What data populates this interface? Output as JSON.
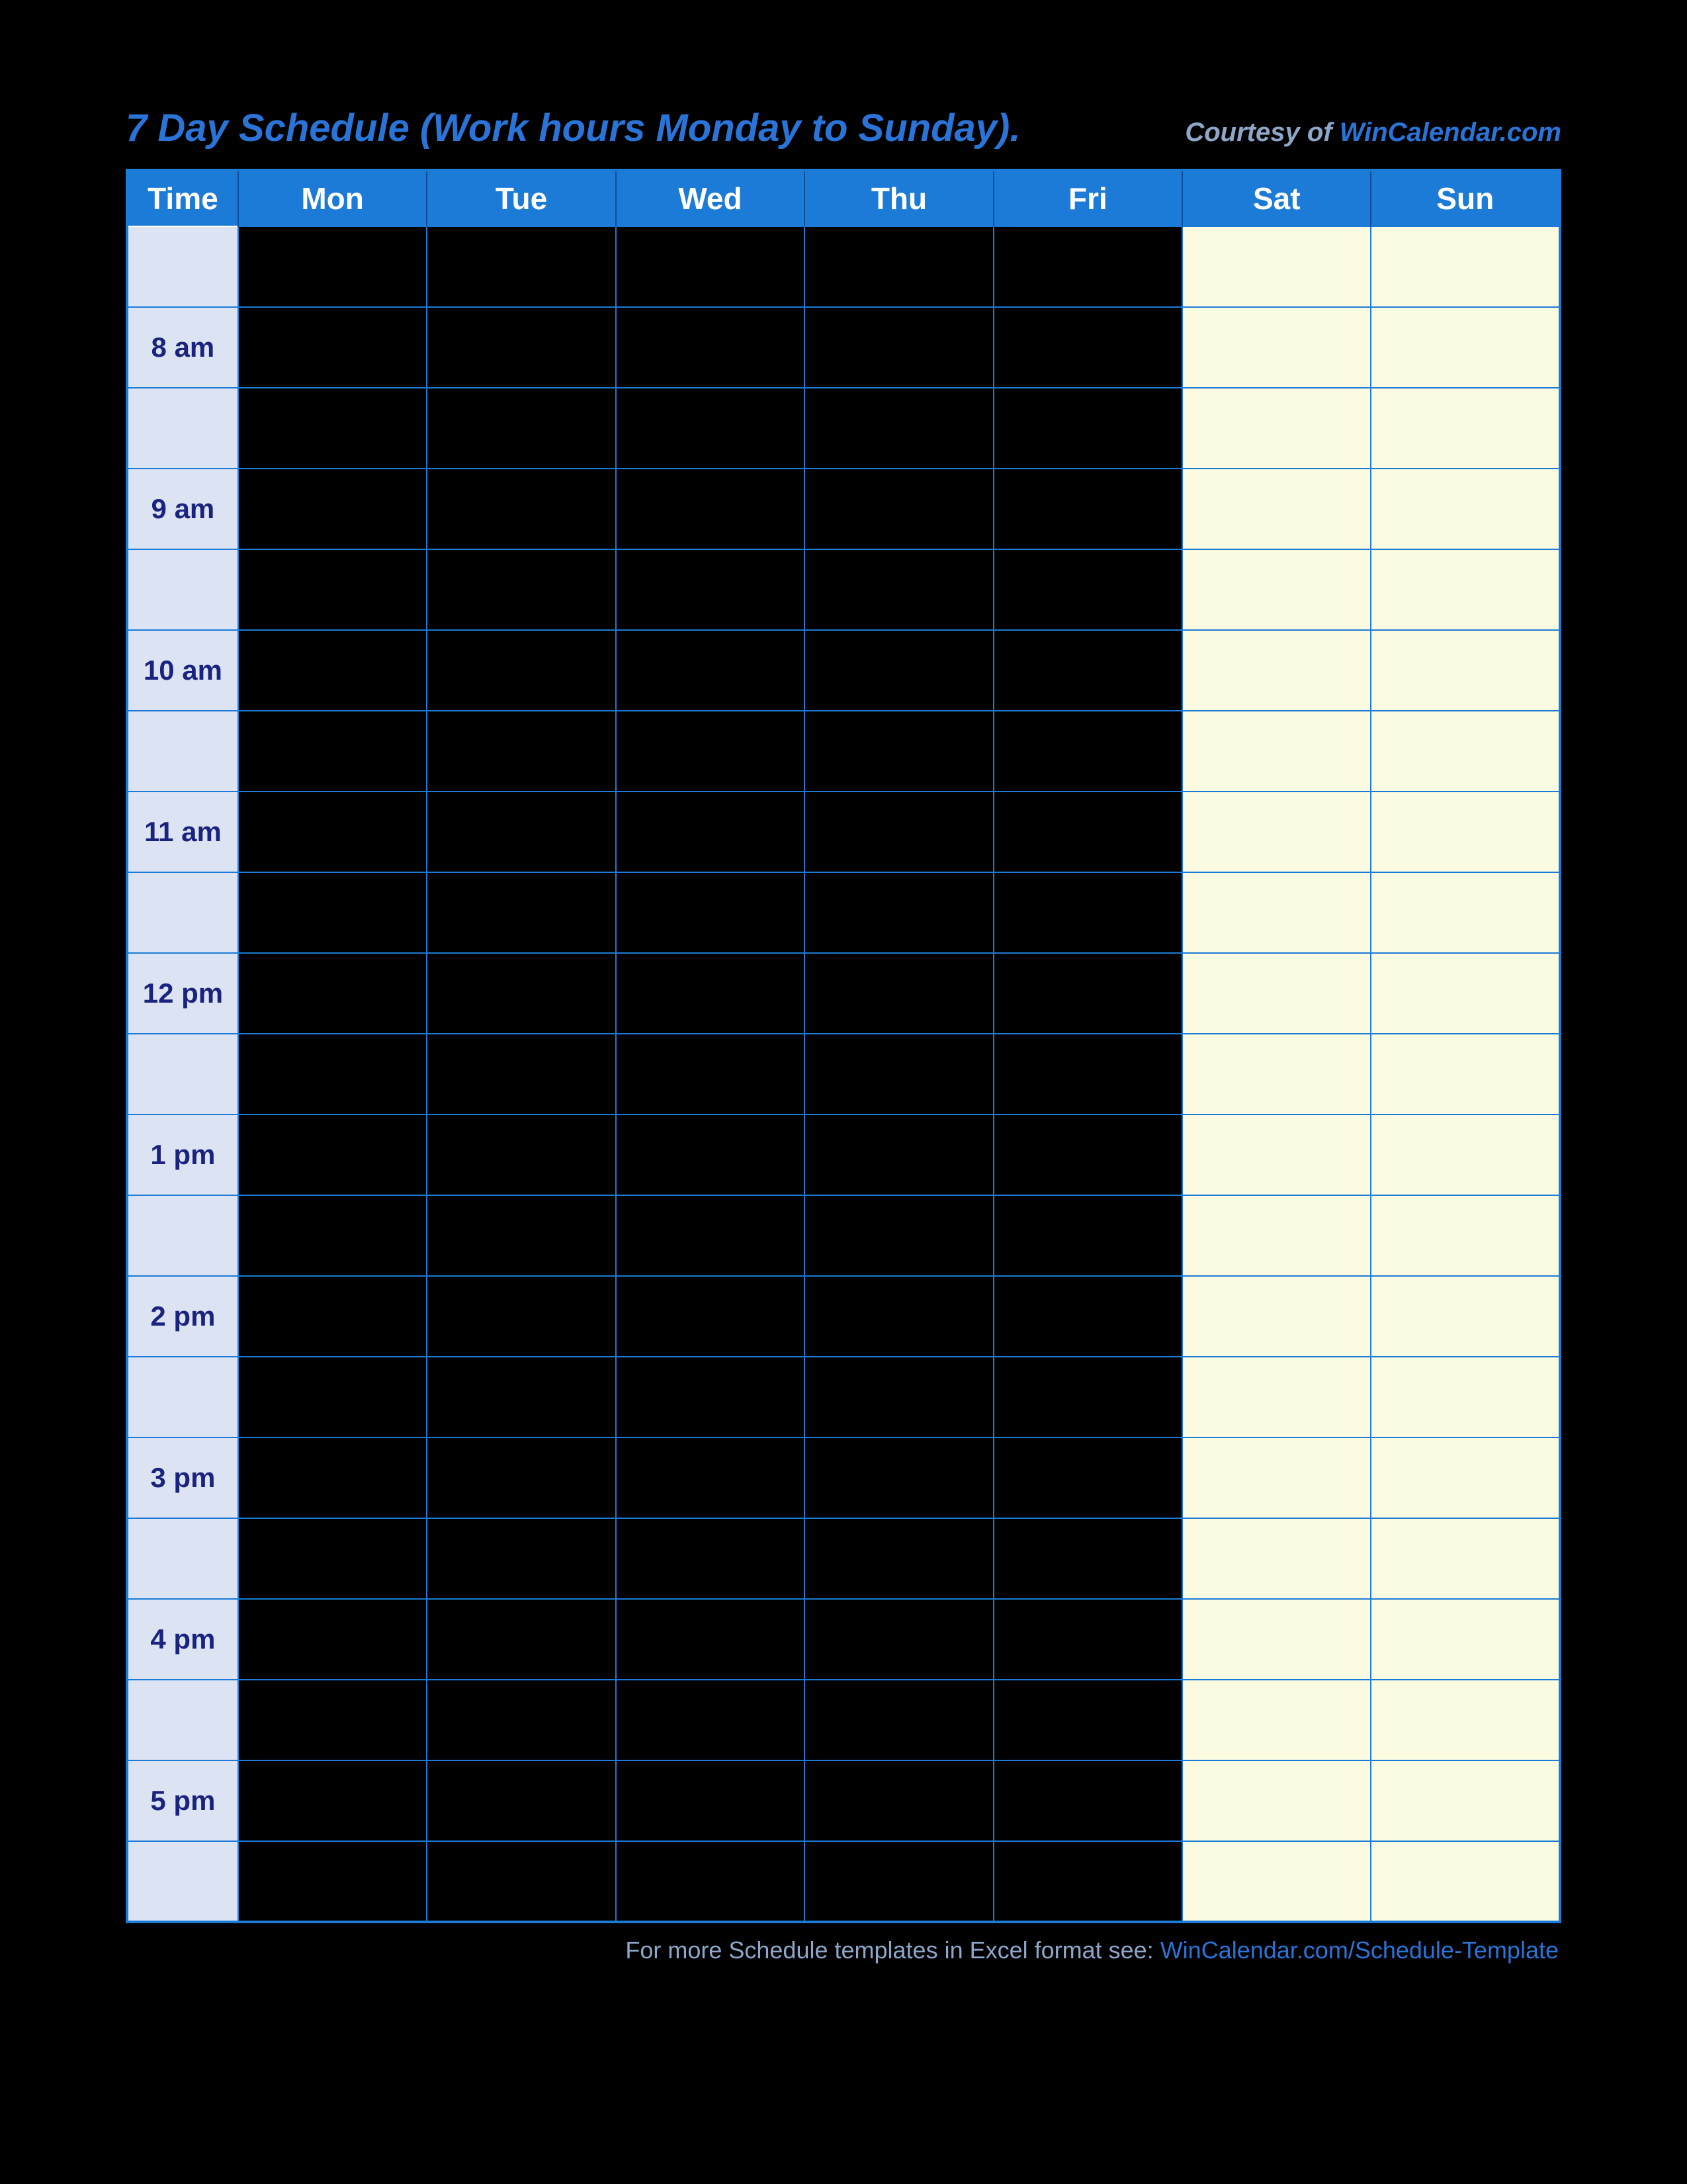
{
  "header": {
    "title": "7 Day Schedule (Work hours Monday to Sunday).",
    "courtesy_prefix": "Courtesy of ",
    "courtesy_link": "WinCalendar.com"
  },
  "columns": {
    "time": "Time",
    "days": [
      "Mon",
      "Tue",
      "Wed",
      "Thu",
      "Fri",
      "Sat",
      "Sun"
    ]
  },
  "weekend_days": [
    "Sat",
    "Sun"
  ],
  "time_slots": [
    {
      "label": "",
      "half_label": ""
    },
    {
      "label": "8 am",
      "half_label": ""
    },
    {
      "label": "9 am",
      "half_label": ""
    },
    {
      "label": "10 am",
      "half_label": ""
    },
    {
      "label": "11 am",
      "half_label": ""
    },
    {
      "label": "12 pm",
      "half_label": ""
    },
    {
      "label": "1 pm",
      "half_label": ""
    },
    {
      "label": "2 pm",
      "half_label": ""
    },
    {
      "label": "3 pm",
      "half_label": ""
    },
    {
      "label": "4 pm",
      "half_label": ""
    },
    {
      "label": "5 pm",
      "half_label": ""
    }
  ],
  "footer": {
    "text": "For more Schedule templates in Excel format see: ",
    "link": "WinCalendar.com/Schedule-Template"
  },
  "colors": {
    "header_bg": "#1c7bd6",
    "time_col_bg": "#dce3f2",
    "time_text": "#1a237e",
    "weekend_bg": "#fafbe0",
    "weekday_bg": "#000000",
    "accent": "#2a74d8"
  }
}
